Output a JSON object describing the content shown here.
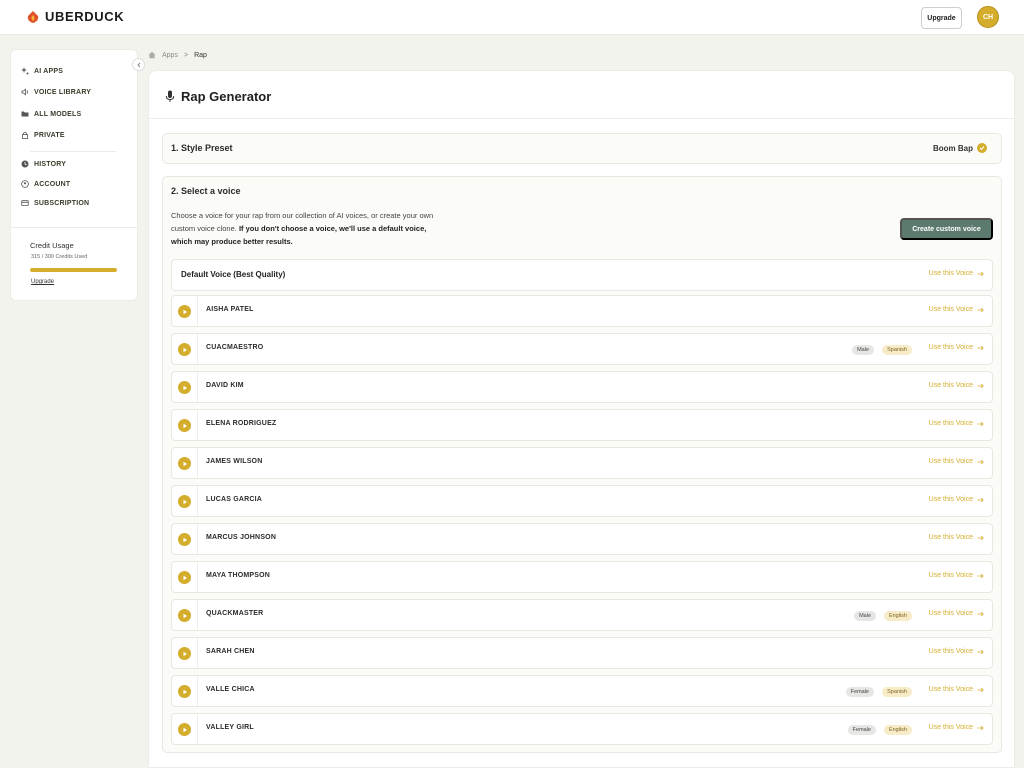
{
  "header": {
    "logo_text": "UBERDUCK",
    "upgrade_label": "Upgrade",
    "avatar_initials": "CH"
  },
  "sidebar": {
    "items": [
      {
        "label": "AI APPS",
        "icon": "sparkle-icon"
      },
      {
        "label": "VOICE LIBRARY",
        "icon": "speaker-icon"
      },
      {
        "label": "ALL MODELS",
        "icon": "folder-icon"
      },
      {
        "label": "PRIVATE",
        "icon": "lock-icon"
      },
      {
        "label": "HISTORY",
        "icon": "clock-icon"
      },
      {
        "label": "ACCOUNT",
        "icon": "user-circle-icon"
      },
      {
        "label": "SUBSCRIPTION",
        "icon": "card-icon"
      }
    ],
    "credit_title": "Credit Usage",
    "credit_text": "315 / 300 Credits Used",
    "credit_progress": 1.0,
    "credit_link": "Upgrade"
  },
  "breadcrumb": {
    "home": "Apps",
    "separator": ">",
    "current": "Rap"
  },
  "page": {
    "title": "Rap Generator"
  },
  "style_preset": {
    "title": "1. Style Preset",
    "value": "Boom Bap"
  },
  "voice_select": {
    "title": "2. Select a voice",
    "desc_plain": "Choose a voice for your rap from our collection of AI voices, or create your own custom voice clone. ",
    "desc_bold": "If you don't choose a voice, we'll use a default voice, which may produce better results.",
    "custom_button": "Create custom voice",
    "default_label": "Default Voice (Best Quality)",
    "use_label": "Use this Voice",
    "voices": [
      {
        "name": "AISHA PATEL",
        "gender": "",
        "language": ""
      },
      {
        "name": "CUACMAESTRO",
        "gender": "Male",
        "language": "Spanish"
      },
      {
        "name": "DAVID KIM",
        "gender": "",
        "language": ""
      },
      {
        "name": "ELENA RODRIGUEZ",
        "gender": "",
        "language": ""
      },
      {
        "name": "JAMES WILSON",
        "gender": "",
        "language": ""
      },
      {
        "name": "LUCAS GARCIA",
        "gender": "",
        "language": ""
      },
      {
        "name": "MARCUS JOHNSON",
        "gender": "",
        "language": ""
      },
      {
        "name": "MAYA THOMPSON",
        "gender": "",
        "language": ""
      },
      {
        "name": "QUACKMASTER",
        "gender": "Male",
        "language": "English"
      },
      {
        "name": "SARAH CHEN",
        "gender": "",
        "language": ""
      },
      {
        "name": "VALLE CHICA",
        "gender": "Female",
        "language": "Spanish"
      },
      {
        "name": "VALLEY GIRL",
        "gender": "Female",
        "language": "English"
      }
    ]
  }
}
